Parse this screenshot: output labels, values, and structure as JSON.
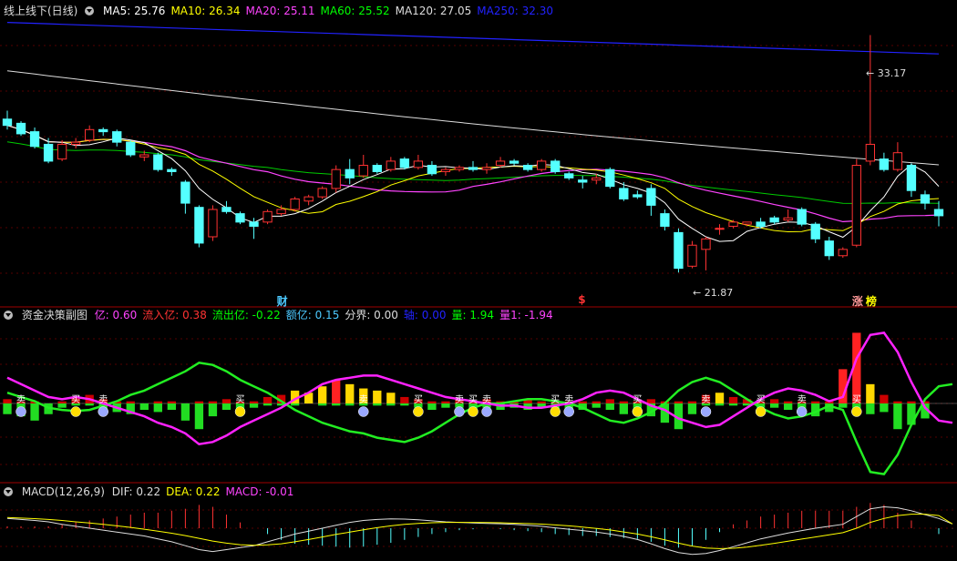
{
  "panels": {
    "main": {
      "title": "线上线下(日线)",
      "legend": [
        {
          "label": "MA5: 25.76",
          "color": "#ffffff"
        },
        {
          "label": "MA10: 26.34",
          "color": "#ffff00"
        },
        {
          "label": "MA20: 25.11",
          "color": "#ff44ff"
        },
        {
          "label": "MA60: 25.52",
          "color": "#00ff00"
        },
        {
          "label": "MA120: 27.05",
          "color": "#dddddd"
        },
        {
          "label": "MA250: 32.30",
          "color": "#2222ff"
        }
      ],
      "high_label": "33.17",
      "low_label": "21.87",
      "markers": [
        {
          "text": "财",
          "color": "#4cc9ff"
        },
        {
          "text": "$",
          "color": "#ff3333"
        },
        {
          "text": "涨",
          "color": "#ff9999"
        },
        {
          "text": "榜",
          "color": "#ffff00"
        }
      ]
    },
    "fund": {
      "title": "资金决策副图",
      "legend": [
        {
          "label": "亿: 0.60",
          "color": "#ff44ff"
        },
        {
          "label": "流入亿: 0.38",
          "color": "#ff3333"
        },
        {
          "label": "流出亿: -0.22",
          "color": "#00ff00"
        },
        {
          "label": "额亿: 0.15",
          "color": "#4cc9ff"
        },
        {
          "label": "分界: 0.00",
          "color": "#dddddd"
        },
        {
          "label": "轴: 0.00",
          "color": "#2222ff"
        },
        {
          "label": "量: 1.94",
          "color": "#00ff00"
        },
        {
          "label": "量1: -1.94",
          "color": "#ff44ff"
        }
      ],
      "sell_label": "卖",
      "buy_label": "买"
    },
    "macd": {
      "title": "MACD(12,26,9)",
      "legend": [
        {
          "label": "DIF: 0.22",
          "color": "#dddddd"
        },
        {
          "label": "DEA: 0.22",
          "color": "#ffff00"
        },
        {
          "label": "MACD: -0.01",
          "color": "#ff44ff"
        }
      ]
    }
  },
  "chart_data": {
    "type": "candlestick",
    "price_range": [
      21.0,
      34.0
    ],
    "grid": true,
    "candles": [
      {
        "o": 29.2,
        "h": 29.6,
        "l": 28.7,
        "c": 28.9
      },
      {
        "o": 29.0,
        "h": 29.1,
        "l": 28.4,
        "c": 28.5
      },
      {
        "o": 28.6,
        "h": 28.8,
        "l": 27.8,
        "c": 27.9
      },
      {
        "o": 28.0,
        "h": 28.3,
        "l": 27.1,
        "c": 27.2
      },
      {
        "o": 27.3,
        "h": 28.2,
        "l": 27.2,
        "c": 28.0
      },
      {
        "o": 28.0,
        "h": 28.3,
        "l": 27.8,
        "c": 28.1
      },
      {
        "o": 28.2,
        "h": 28.9,
        "l": 28.1,
        "c": 28.7
      },
      {
        "o": 28.7,
        "h": 28.8,
        "l": 28.4,
        "c": 28.6
      },
      {
        "o": 28.6,
        "h": 28.7,
        "l": 27.9,
        "c": 28.1
      },
      {
        "o": 28.1,
        "h": 28.2,
        "l": 27.4,
        "c": 27.5
      },
      {
        "o": 27.4,
        "h": 27.7,
        "l": 27.2,
        "c": 27.5
      },
      {
        "o": 27.5,
        "h": 27.6,
        "l": 26.7,
        "c": 26.8
      },
      {
        "o": 26.8,
        "h": 26.9,
        "l": 26.5,
        "c": 26.7
      },
      {
        "o": 26.2,
        "h": 26.3,
        "l": 24.7,
        "c": 25.2
      },
      {
        "o": 25.0,
        "h": 25.1,
        "l": 23.1,
        "c": 23.3
      },
      {
        "o": 23.6,
        "h": 25.1,
        "l": 23.4,
        "c": 24.9
      },
      {
        "o": 25.0,
        "h": 25.3,
        "l": 24.7,
        "c": 24.8
      },
      {
        "o": 24.7,
        "h": 24.8,
        "l": 24.2,
        "c": 24.3
      },
      {
        "o": 24.3,
        "h": 24.5,
        "l": 23.5,
        "c": 24.1
      },
      {
        "o": 24.3,
        "h": 24.9,
        "l": 24.2,
        "c": 24.8
      },
      {
        "o": 24.7,
        "h": 25.1,
        "l": 24.6,
        "c": 24.9
      },
      {
        "o": 24.9,
        "h": 25.5,
        "l": 24.8,
        "c": 25.4
      },
      {
        "o": 25.3,
        "h": 25.6,
        "l": 25.1,
        "c": 25.5
      },
      {
        "o": 25.5,
        "h": 26.0,
        "l": 25.4,
        "c": 25.9
      },
      {
        "o": 25.9,
        "h": 27.0,
        "l": 25.7,
        "c": 26.8
      },
      {
        "o": 26.8,
        "h": 27.3,
        "l": 26.1,
        "c": 26.4
      },
      {
        "o": 26.5,
        "h": 27.5,
        "l": 26.4,
        "c": 27.0
      },
      {
        "o": 27.0,
        "h": 27.1,
        "l": 26.6,
        "c": 26.7
      },
      {
        "o": 26.8,
        "h": 27.4,
        "l": 26.7,
        "c": 27.2
      },
      {
        "o": 27.3,
        "h": 27.4,
        "l": 26.8,
        "c": 26.9
      },
      {
        "o": 26.9,
        "h": 27.5,
        "l": 26.8,
        "c": 27.2
      },
      {
        "o": 27.0,
        "h": 27.2,
        "l": 26.5,
        "c": 26.6
      },
      {
        "o": 26.7,
        "h": 26.9,
        "l": 26.5,
        "c": 26.8
      },
      {
        "o": 26.8,
        "h": 27.0,
        "l": 26.7,
        "c": 26.9
      },
      {
        "o": 26.9,
        "h": 27.2,
        "l": 26.7,
        "c": 26.8
      },
      {
        "o": 26.8,
        "h": 27.1,
        "l": 26.6,
        "c": 26.9
      },
      {
        "o": 27.0,
        "h": 27.4,
        "l": 26.9,
        "c": 27.2
      },
      {
        "o": 27.2,
        "h": 27.3,
        "l": 27.0,
        "c": 27.1
      },
      {
        "o": 27.0,
        "h": 27.1,
        "l": 26.7,
        "c": 26.8
      },
      {
        "o": 26.8,
        "h": 27.3,
        "l": 26.7,
        "c": 27.2
      },
      {
        "o": 27.2,
        "h": 27.3,
        "l": 26.6,
        "c": 26.7
      },
      {
        "o": 26.6,
        "h": 26.7,
        "l": 26.3,
        "c": 26.4
      },
      {
        "o": 26.3,
        "h": 26.5,
        "l": 25.9,
        "c": 26.2
      },
      {
        "o": 26.3,
        "h": 26.6,
        "l": 26.1,
        "c": 26.4
      },
      {
        "o": 26.8,
        "h": 26.9,
        "l": 25.9,
        "c": 26.0
      },
      {
        "o": 25.9,
        "h": 26.2,
        "l": 25.3,
        "c": 25.4
      },
      {
        "o": 25.6,
        "h": 25.8,
        "l": 25.4,
        "c": 25.5
      },
      {
        "o": 25.9,
        "h": 26.1,
        "l": 24.6,
        "c": 25.1
      },
      {
        "o": 24.7,
        "h": 24.9,
        "l": 23.9,
        "c": 24.1
      },
      {
        "o": 23.8,
        "h": 24.0,
        "l": 21.9,
        "c": 22.1
      },
      {
        "o": 22.2,
        "h": 23.4,
        "l": 22.1,
        "c": 23.2
      },
      {
        "o": 23.0,
        "h": 23.6,
        "l": 22.0,
        "c": 23.5
      },
      {
        "o": 24.0,
        "h": 24.2,
        "l": 23.7,
        "c": 24.0
      },
      {
        "o": 24.1,
        "h": 24.4,
        "l": 24.0,
        "c": 24.3
      },
      {
        "o": 24.2,
        "h": 24.3,
        "l": 24.1,
        "c": 24.3
      },
      {
        "o": 24.3,
        "h": 24.5,
        "l": 24.0,
        "c": 24.1
      },
      {
        "o": 24.5,
        "h": 24.6,
        "l": 24.2,
        "c": 24.3
      },
      {
        "o": 24.4,
        "h": 24.9,
        "l": 24.3,
        "c": 24.5
      },
      {
        "o": 24.9,
        "h": 25.0,
        "l": 24.1,
        "c": 24.2
      },
      {
        "o": 24.2,
        "h": 24.3,
        "l": 23.3,
        "c": 23.5
      },
      {
        "o": 23.4,
        "h": 23.6,
        "l": 22.5,
        "c": 22.7
      },
      {
        "o": 22.7,
        "h": 23.1,
        "l": 22.6,
        "c": 23.0
      },
      {
        "o": 23.2,
        "h": 27.3,
        "l": 23.1,
        "c": 27.0
      },
      {
        "o": 27.2,
        "h": 33.2,
        "l": 27.0,
        "c": 28.0
      },
      {
        "o": 27.3,
        "h": 27.6,
        "l": 26.7,
        "c": 26.8
      },
      {
        "o": 26.8,
        "h": 28.1,
        "l": 26.7,
        "c": 27.6
      },
      {
        "o": 27.0,
        "h": 27.1,
        "l": 25.5,
        "c": 25.8
      },
      {
        "o": 25.6,
        "h": 25.8,
        "l": 24.9,
        "c": 25.2
      },
      {
        "o": 24.9,
        "h": 25.3,
        "l": 24.1,
        "c": 24.6
      }
    ],
    "flow": [
      {
        "r": 0.2,
        "g": 0.5
      },
      {
        "r": 0.1,
        "g": 0.6
      },
      {
        "r": 0.1,
        "g": 0.8
      },
      {
        "r": 0.0,
        "g": 0.5
      },
      {
        "r": 0.1,
        "g": 0.2
      },
      {
        "r": 0.3,
        "g": 0.1
      },
      {
        "r": 0.4,
        "g": 0.1
      },
      {
        "r": 0.2,
        "g": 0.3
      },
      {
        "r": 0.1,
        "g": 0.4
      },
      {
        "r": 0.1,
        "g": 0.5
      },
      {
        "r": 0.0,
        "g": 0.3
      },
      {
        "r": 0.1,
        "g": 0.4
      },
      {
        "r": 0.1,
        "g": 0.3
      },
      {
        "r": 0.0,
        "g": 0.8
      },
      {
        "r": 0.1,
        "g": 1.2
      },
      {
        "r": 0.1,
        "g": 0.6
      },
      {
        "r": 0.2,
        "g": 0.3
      },
      {
        "r": 0.1,
        "g": 0.3
      },
      {
        "r": 0.1,
        "g": 0.2
      },
      {
        "r": 0.3,
        "g": 0.1
      },
      {
        "r": 0.4,
        "g": 0.1
      },
      {
        "r": 0.6,
        "g": 0.1
      },
      {
        "r": 0.5,
        "g": 0.0
      },
      {
        "r": 0.8,
        "g": 0.1
      },
      {
        "r": 1.1,
        "g": 0.1
      },
      {
        "r": 0.9,
        "g": 0.1
      },
      {
        "r": 0.7,
        "g": 0.1
      },
      {
        "r": 0.6,
        "g": 0.1
      },
      {
        "r": 0.5,
        "g": 0.1
      },
      {
        "r": 0.3,
        "g": 0.1
      },
      {
        "r": 0.2,
        "g": 0.2
      },
      {
        "r": 0.1,
        "g": 0.3
      },
      {
        "r": 0.1,
        "g": 0.2
      },
      {
        "r": 0.2,
        "g": 0.2
      },
      {
        "r": 0.1,
        "g": 0.3
      },
      {
        "r": 0.2,
        "g": 0.2
      },
      {
        "r": 0.1,
        "g": 0.3
      },
      {
        "r": 0.1,
        "g": 0.2
      },
      {
        "r": 0.2,
        "g": 0.3
      },
      {
        "r": 0.1,
        "g": 0.2
      },
      {
        "r": 0.1,
        "g": 0.3
      },
      {
        "r": 0.1,
        "g": 0.4
      },
      {
        "r": 0.1,
        "g": 0.3
      },
      {
        "r": 0.1,
        "g": 0.2
      },
      {
        "r": 0.2,
        "g": 0.3
      },
      {
        "r": 0.1,
        "g": 0.5
      },
      {
        "r": 0.1,
        "g": 0.4
      },
      {
        "r": 0.2,
        "g": 0.6
      },
      {
        "r": 0.1,
        "g": 0.9
      },
      {
        "r": 0.1,
        "g": 1.2
      },
      {
        "r": 0.1,
        "g": 0.5
      },
      {
        "r": 0.4,
        "g": 0.1
      },
      {
        "r": 0.5,
        "g": 0.1
      },
      {
        "r": 0.3,
        "g": 0.1
      },
      {
        "r": 0.2,
        "g": 0.1
      },
      {
        "r": 0.1,
        "g": 0.2
      },
      {
        "r": 0.2,
        "g": 0.2
      },
      {
        "r": 0.1,
        "g": 0.3
      },
      {
        "r": 0.1,
        "g": 0.4
      },
      {
        "r": 0.1,
        "g": 0.6
      },
      {
        "r": 0.1,
        "g": 0.4
      },
      {
        "r": 1.6,
        "g": 0.2
      },
      {
        "r": 3.3,
        "g": 0.3
      },
      {
        "r": 0.9,
        "g": 0.5
      },
      {
        "r": 0.4,
        "g": 0.4
      },
      {
        "r": 0.1,
        "g": 1.2
      },
      {
        "r": 0.1,
        "g": 1.0
      },
      {
        "r": 0.1,
        "g": 0.7
      }
    ],
    "fund_lines": {
      "green": [
        0.5,
        0.3,
        0.1,
        -0.2,
        -0.3,
        -0.35,
        -0.3,
        -0.1,
        0.1,
        0.4,
        0.6,
        0.9,
        1.2,
        1.5,
        1.9,
        1.8,
        1.5,
        1.1,
        0.8,
        0.5,
        0.1,
        -0.3,
        -0.6,
        -0.9,
        -1.1,
        -1.3,
        -1.4,
        -1.6,
        -1.7,
        -1.8,
        -1.6,
        -1.3,
        -0.9,
        -0.5,
        -0.2,
        0.0,
        0.0,
        0.1,
        0.2,
        0.2,
        0.1,
        0.0,
        -0.2,
        -0.5,
        -0.8,
        -0.9,
        -0.7,
        -0.4,
        0.0,
        0.6,
        1.0,
        1.2,
        1.0,
        0.6,
        0.2,
        -0.2,
        -0.5,
        -0.7,
        -0.6,
        -0.4,
        -0.1,
        -0.3,
        -1.8,
        -3.2,
        -3.3,
        -2.4,
        -1.0,
        0.2,
        0.8,
        0.9
      ],
      "magenta": [
        1.2,
        0.9,
        0.6,
        0.3,
        0.2,
        0.3,
        0.2,
        0.0,
        -0.2,
        -0.4,
        -0.6,
        -0.9,
        -1.1,
        -1.4,
        -1.9,
        -1.8,
        -1.5,
        -1.1,
        -0.8,
        -0.5,
        -0.2,
        0.2,
        0.5,
        0.9,
        1.1,
        1.2,
        1.3,
        1.3,
        1.1,
        0.9,
        0.7,
        0.5,
        0.3,
        0.2,
        0.1,
        0.0,
        -0.1,
        -0.1,
        -0.2,
        -0.2,
        -0.1,
        0.0,
        0.2,
        0.5,
        0.6,
        0.5,
        0.2,
        -0.1,
        -0.3,
        -0.7,
        -0.9,
        -1.1,
        -1.0,
        -0.6,
        -0.2,
        0.2,
        0.5,
        0.7,
        0.6,
        0.4,
        0.1,
        0.3,
        2.1,
        3.2,
        3.3,
        2.4,
        1.0,
        -0.2,
        -0.8,
        -0.9
      ]
    },
    "signals": [
      {
        "i": 1,
        "type": "sell"
      },
      {
        "i": 5,
        "type": "buy"
      },
      {
        "i": 7,
        "type": "sell"
      },
      {
        "i": 17,
        "type": "buy"
      },
      {
        "i": 26,
        "type": "sell"
      },
      {
        "i": 30,
        "type": "buy"
      },
      {
        "i": 33,
        "type": "sell"
      },
      {
        "i": 34,
        "type": "buy"
      },
      {
        "i": 35,
        "type": "sell"
      },
      {
        "i": 40,
        "type": "buy"
      },
      {
        "i": 41,
        "type": "sell"
      },
      {
        "i": 46,
        "type": "buy"
      },
      {
        "i": 51,
        "type": "sell"
      },
      {
        "i": 55,
        "type": "buy"
      },
      {
        "i": 58,
        "type": "sell"
      },
      {
        "i": 62,
        "type": "buy"
      }
    ],
    "macd": {
      "range": [
        -1.5,
        1.5
      ],
      "dif": [
        0.5,
        0.45,
        0.4,
        0.33,
        0.2,
        0.1,
        0.0,
        -0.1,
        -0.2,
        -0.3,
        -0.4,
        -0.55,
        -0.7,
        -0.9,
        -1.1,
        -1.2,
        -1.1,
        -1.0,
        -0.9,
        -0.7,
        -0.5,
        -0.3,
        -0.15,
        0.0,
        0.15,
        0.3,
        0.4,
        0.45,
        0.48,
        0.47,
        0.43,
        0.38,
        0.33,
        0.3,
        0.27,
        0.25,
        0.23,
        0.2,
        0.15,
        0.1,
        0.02,
        -0.05,
        -0.12,
        -0.2,
        -0.3,
        -0.42,
        -0.58,
        -0.8,
        -1.05,
        -1.25,
        -1.35,
        -1.3,
        -1.15,
        -0.95,
        -0.75,
        -0.55,
        -0.4,
        -0.25,
        -0.12,
        0.0,
        0.1,
        0.2,
        0.6,
        1.0,
        1.1,
        1.05,
        0.9,
        0.7,
        0.5,
        0.22
      ],
      "dea": [
        0.55,
        0.52,
        0.49,
        0.45,
        0.4,
        0.33,
        0.27,
        0.2,
        0.12,
        0.04,
        -0.05,
        -0.15,
        -0.26,
        -0.38,
        -0.52,
        -0.66,
        -0.77,
        -0.85,
        -0.88,
        -0.86,
        -0.8,
        -0.7,
        -0.58,
        -0.45,
        -0.32,
        -0.2,
        -0.08,
        0.03,
        0.12,
        0.2,
        0.25,
        0.28,
        0.3,
        0.3,
        0.3,
        0.29,
        0.28,
        0.26,
        0.24,
        0.21,
        0.17,
        0.12,
        0.06,
        -0.01,
        -0.09,
        -0.19,
        -0.3,
        -0.44,
        -0.6,
        -0.77,
        -0.92,
        -1.02,
        -1.05,
        -1.03,
        -0.97,
        -0.88,
        -0.78,
        -0.67,
        -0.56,
        -0.45,
        -0.34,
        -0.23,
        0.0,
        0.3,
        0.5,
        0.65,
        0.72,
        0.72,
        0.65,
        0.22
      ],
      "hist": [
        0.1,
        0.1,
        0.1,
        0.1,
        0.2,
        0.3,
        0.4,
        0.5,
        0.6,
        0.7,
        0.8,
        0.8,
        0.9,
        1.0,
        1.2,
        1.1,
        0.7,
        0.3,
        0.0,
        -0.3,
        -0.6,
        -0.8,
        -0.85,
        -0.9,
        -0.95,
        -1.0,
        -0.95,
        -0.85,
        -0.75,
        -0.6,
        -0.45,
        -0.3,
        -0.2,
        -0.1,
        -0.05,
        0.0,
        -0.05,
        -0.1,
        -0.15,
        -0.2,
        -0.3,
        -0.35,
        -0.4,
        -0.4,
        -0.45,
        -0.5,
        -0.55,
        -0.7,
        -0.9,
        -1.0,
        -0.9,
        -0.6,
        -0.2,
        0.2,
        0.4,
        0.6,
        0.7,
        0.8,
        0.9,
        0.9,
        0.9,
        0.9,
        1.1,
        1.3,
        1.2,
        0.8,
        0.4,
        0.0,
        -0.3,
        -0.01
      ]
    }
  }
}
